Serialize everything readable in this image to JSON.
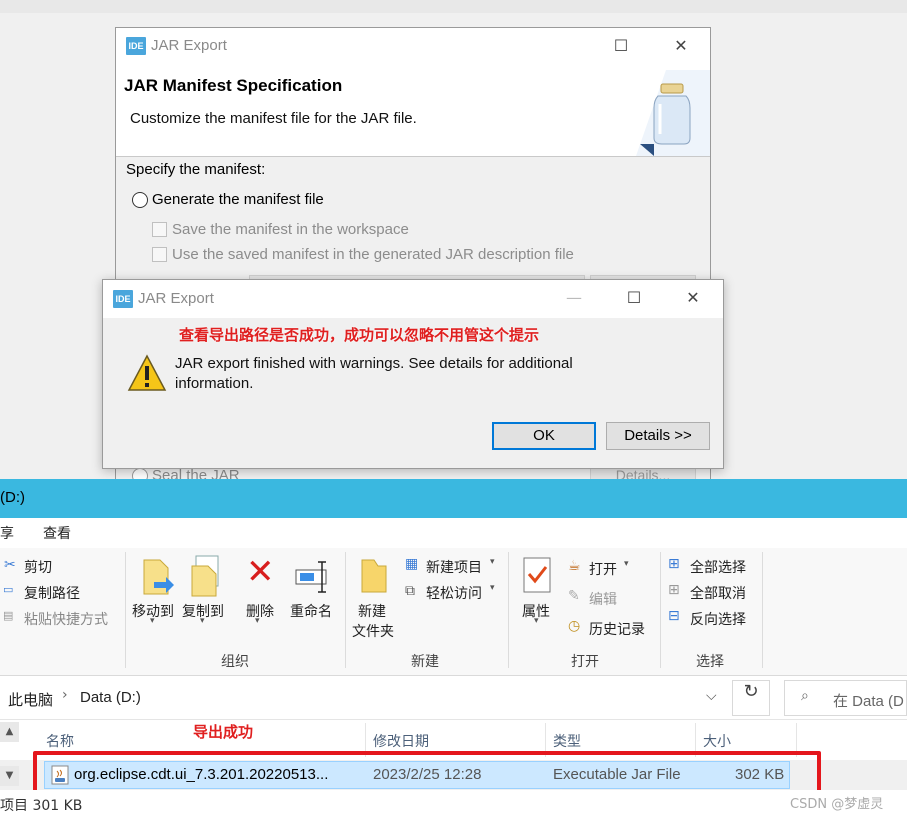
{
  "manifest_dialog": {
    "app_badge": "IDE",
    "window_title": "JAR Export",
    "header_title": "JAR Manifest Specification",
    "header_subtitle": "Customize the manifest file for the JAR file.",
    "specify_label": "Specify the manifest:",
    "generate_option": "Generate the manifest file",
    "save_option": "Save the manifest in the workspace",
    "use_saved_option": "Use the saved manifest in the generated JAR description file",
    "seal_option": "Seal the JAR",
    "details_button": "Details..."
  },
  "warning_dialog": {
    "app_badge": "IDE",
    "window_title": "JAR Export",
    "annotation": "查看导出路径是否成功，成功可以忽略不用管这个提示",
    "message_line1": "JAR export finished with warnings. See details for additional",
    "message_line2": "information.",
    "ok_button": "OK",
    "details_button": "Details >>"
  },
  "explorer": {
    "title": "(D:)",
    "menu": {
      "share": "享",
      "view": "查看"
    },
    "ribbon": {
      "cut": "剪切",
      "copy_path": "复制路径",
      "paste_shortcut": "粘贴快捷方式",
      "move_to": "移动到",
      "copy_to": "复制到",
      "delete": "删除",
      "rename": "重命名",
      "new_folder": "新建\n文件夹",
      "new_folder_line1": "新建",
      "new_folder_line2": "文件夹",
      "new_item": "新建项目",
      "easy_access": "轻松访问",
      "properties": "属性",
      "open": "打开",
      "edit": "编辑",
      "history": "历史记录",
      "select_all": "全部选择",
      "select_none": "全部取消",
      "invert_selection": "反向选择",
      "group_organize": "组织",
      "group_new": "新建",
      "group_open": "打开",
      "group_select": "选择"
    },
    "breadcrumb": [
      "此电脑",
      "Data (D:)"
    ],
    "search_placeholder": "在 Data (D",
    "columns": {
      "name": "名称",
      "modified": "修改日期",
      "type": "类型",
      "size": "大小"
    },
    "annotation": "导出成功",
    "file": {
      "name": "org.eclipse.cdt.ui_7.3.201.20220513...",
      "modified": "2023/2/25 12:28",
      "type": "Executable Jar File",
      "size": "302 KB"
    },
    "status": "项目  301 KB",
    "watermark": "CSDN @梦虚灵"
  }
}
